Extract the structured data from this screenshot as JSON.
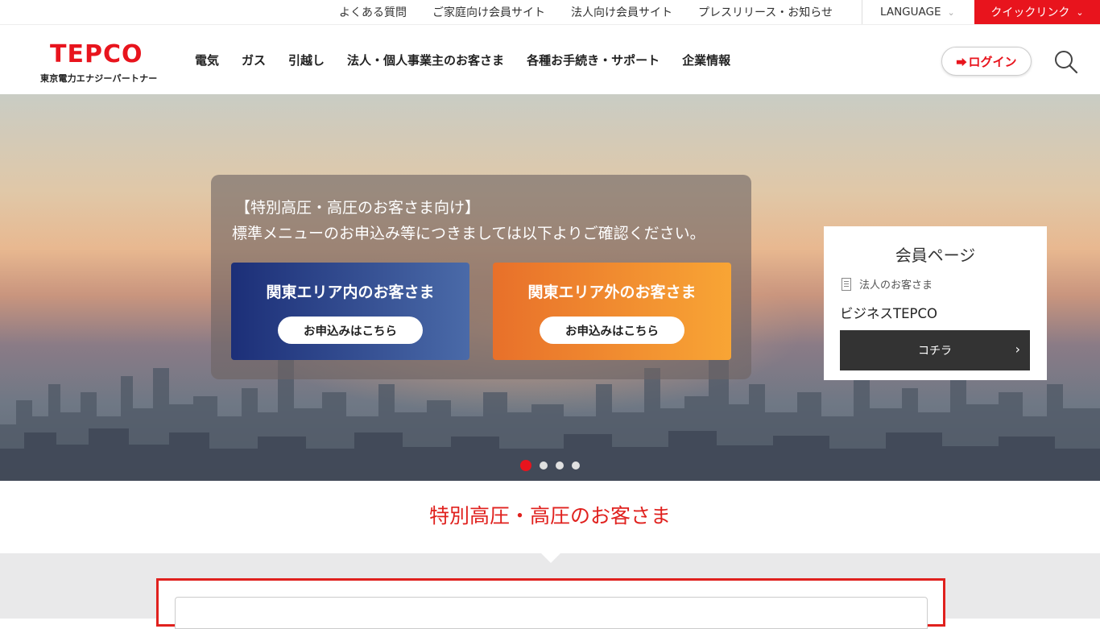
{
  "utility": {
    "links": [
      "よくある質問",
      "ご家庭向け会員サイト",
      "法人向け会員サイト",
      "プレスリリース・お知らせ"
    ],
    "language": "LANGUAGE",
    "quick_link": "クイックリンク"
  },
  "header": {
    "logo_text": "TEPCO",
    "logo_sub": "東京電力エナジーパートナー",
    "nav": [
      "電気",
      "ガス",
      "引越し",
      "法人・個人事業主のお客さま",
      "各種お手続き・サポート",
      "企業情報"
    ],
    "login": "ログイン"
  },
  "hero": {
    "line1": "【特別高圧・高圧のお客さま向け】",
    "line2": "標準メニューのお申込み等につきましては以下よりご確認ください。",
    "cards": [
      {
        "title": "関東エリア内のお客さま",
        "cta": "お申込みはこちら"
      },
      {
        "title": "関東エリア外のお客さま",
        "cta": "お申込みはこちら"
      }
    ],
    "slides_total": 4,
    "slide_active": 1
  },
  "member": {
    "title": "会員ページ",
    "category": "法人のお客さま",
    "name": "ビジネスTEPCO",
    "button": "コチラ"
  },
  "section": {
    "title": "特別高圧・高圧のお客さま"
  },
  "colors": {
    "brand_red": "#e8141d",
    "section_red": "#e0211e",
    "card_in": "#1c2f78",
    "card_out": "#f8a535"
  },
  "icons": [
    "chevron-down-icon",
    "login-icon",
    "search-icon",
    "document-icon",
    "chevron-right-icon"
  ]
}
